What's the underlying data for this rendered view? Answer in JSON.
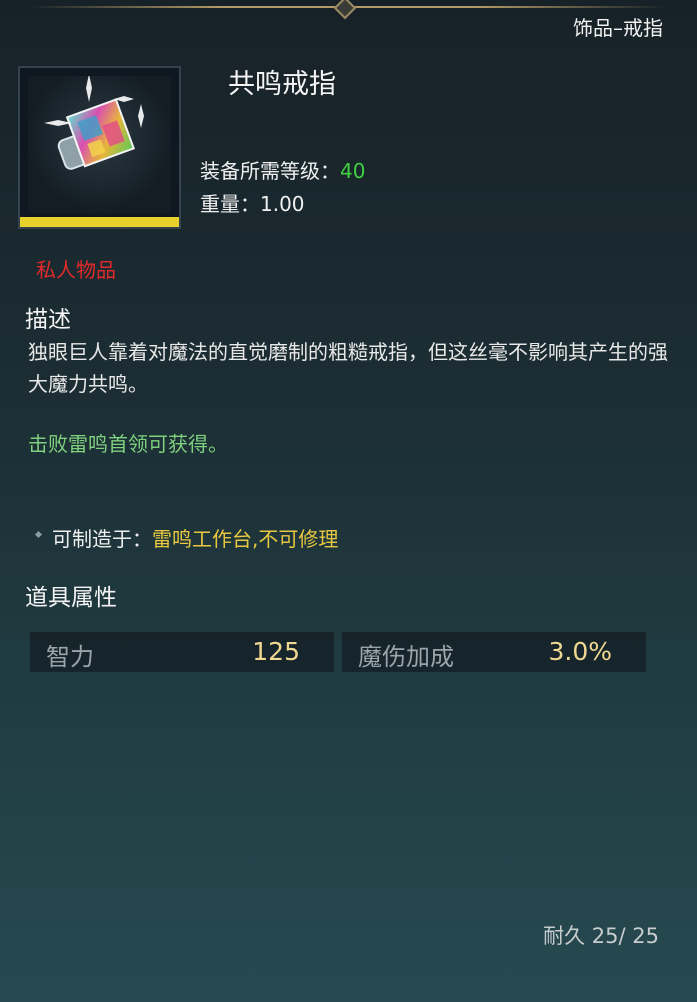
{
  "header": {
    "category": "饰品–戒指"
  },
  "item": {
    "name": "共鸣戒指",
    "icon": "crystal-ring-icon",
    "required_level_label": "装备所需等级：",
    "required_level": "40",
    "weight_label": "重量：",
    "weight": "1.00",
    "private_tag": "私人物品"
  },
  "description": {
    "title": "描述",
    "text": "独眼巨人靠着对魔法的直觉磨制的粗糙戒指，但这丝毫不影响其产生的强大魔力共鸣。",
    "obtain": "击败雷鸣首领可获得。"
  },
  "crafting": {
    "label": "可制造于：",
    "place": "雷鸣工作台,不可修理"
  },
  "attributes": {
    "title": "道具属性",
    "items": [
      {
        "name": "智力",
        "value": "125"
      },
      {
        "name": "魔伤加成",
        "value": "3.0%"
      }
    ]
  },
  "durability": {
    "label": "耐久",
    "current": "25/",
    "max": "25"
  },
  "colors": {
    "quality_bar": "#e6d22a",
    "level_value": "#3fd13f",
    "private": "#e22a2a",
    "obtain": "#7fd07f",
    "craft_place": "#e8c840"
  }
}
